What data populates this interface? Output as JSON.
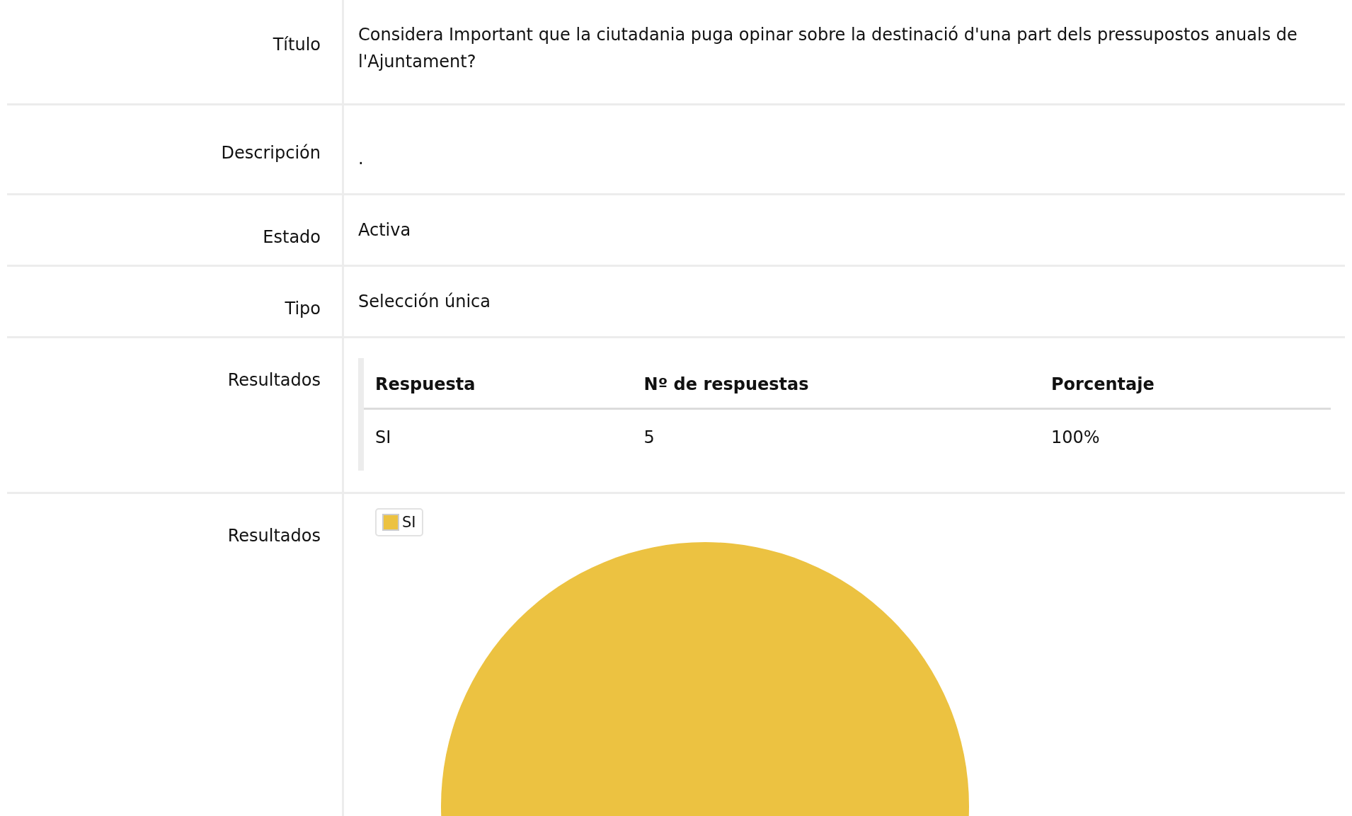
{
  "fields": [
    {
      "kind": "text",
      "label": "Título",
      "value": "Considera Important que la ciutadania puga opinar sobre la destinació d'una part dels pressupostos anuals de l'Ajuntament?"
    },
    {
      "kind": "text",
      "label": "Descripción",
      "value": "."
    },
    {
      "kind": "text",
      "label": "Estado",
      "value": "Activa"
    },
    {
      "kind": "text",
      "label": "Tipo",
      "value": "Selección única"
    },
    {
      "kind": "table",
      "label": "Resultados",
      "columns": [
        "Respuesta",
        "Nº de respuestas",
        "Porcentaje"
      ],
      "rows": [
        [
          "SI",
          "5",
          "100%"
        ]
      ]
    },
    {
      "kind": "chart",
      "label": "Resultados",
      "chart_data": {
        "type": "pie",
        "categories": [
          "SI"
        ],
        "series": [
          {
            "color": "#ecc241",
            "values": [
              100
            ]
          }
        ]
      }
    }
  ]
}
